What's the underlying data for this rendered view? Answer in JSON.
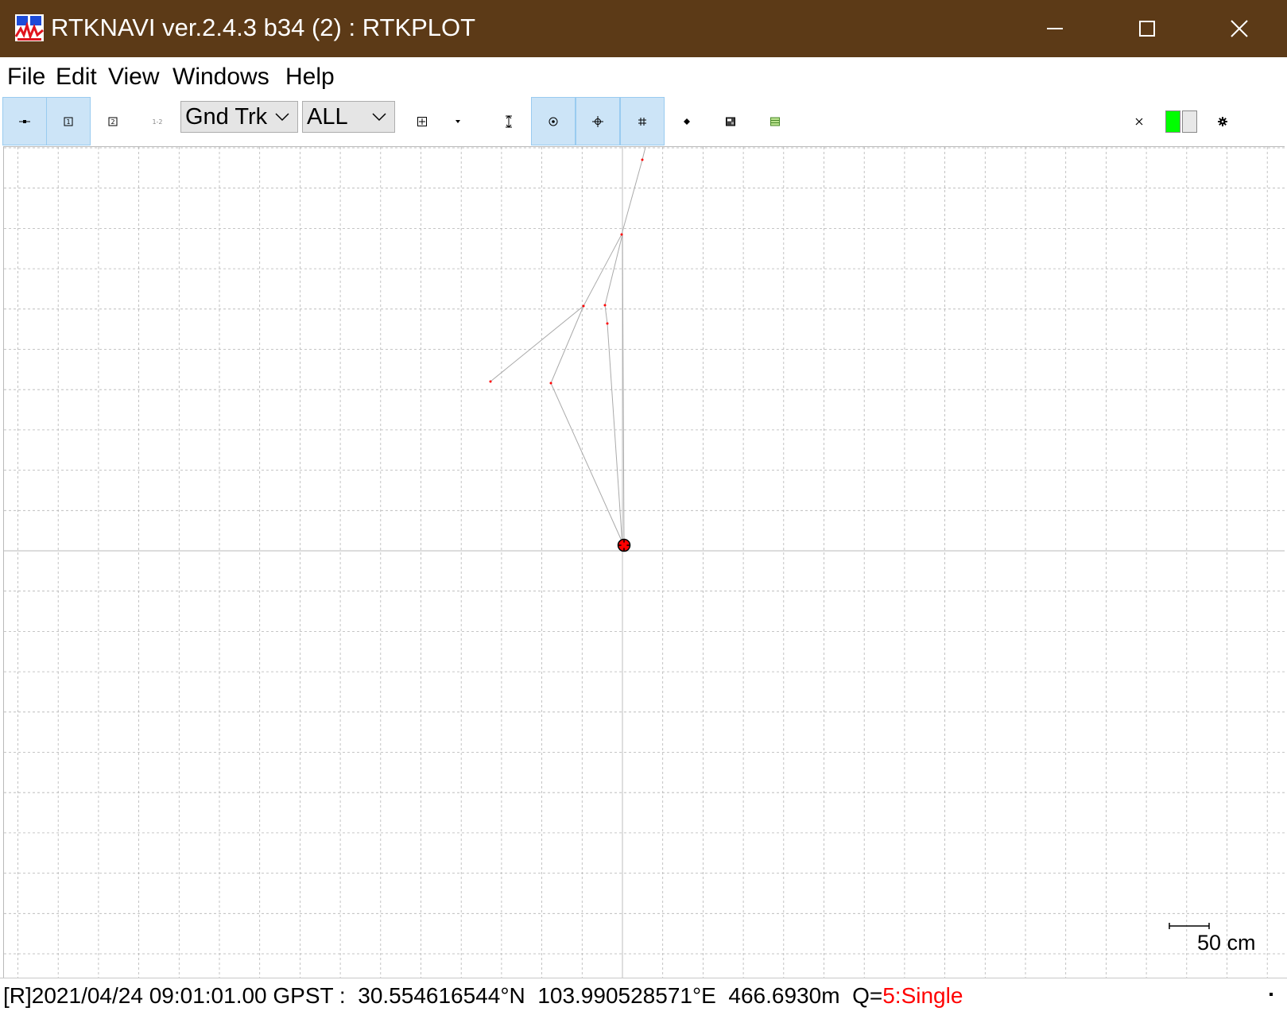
{
  "window": {
    "title": "RTKNAVI ver.2.4.3 b34 (2) : RTKPLOT",
    "controls": [
      "minimize-icon",
      "maximize-icon",
      "close-icon"
    ],
    "title_bar_color": "#5c3a17"
  },
  "menu": {
    "file": "File",
    "edit": "Edit",
    "view": "View",
    "windows": "Windows",
    "help": "Help"
  },
  "toolbar": {
    "plot_type": "Gnd Trk",
    "quality_filter": "ALL",
    "buttons": [
      {
        "icon": "solution-rover-icon",
        "active": true
      },
      {
        "icon": "solution-1-icon",
        "label": "1",
        "active": true
      },
      {
        "icon": "solution-2-icon",
        "label": "2",
        "active": false
      },
      {
        "icon": "solution-12-icon",
        "label": "12",
        "active": false
      },
      {
        "icon": "zoom-fit-icon",
        "active": false
      },
      {
        "icon": "dropdown-icon",
        "active": false
      },
      {
        "icon": "vertical-range-icon",
        "active": false
      },
      {
        "icon": "center-origin-icon",
        "active": true
      },
      {
        "icon": "crosshair-icon",
        "active": true
      },
      {
        "icon": "grid-icon",
        "active": true
      },
      {
        "icon": "point-icon",
        "active": false
      },
      {
        "icon": "map-image-icon",
        "active": false
      },
      {
        "icon": "map-layer-icon",
        "active": false
      },
      {
        "icon": "clear-icon",
        "active": false
      },
      {
        "icon": "settings-gear-icon",
        "active": false
      }
    ],
    "status_colors": {
      "connected": "#00ff00",
      "idle": "#e8e8e8"
    }
  },
  "plot": {
    "scale_label": "50 cm",
    "track_color": "#aaaaaa",
    "point_color": "#ff0000",
    "grid_color": "#b4b4b4"
  },
  "status": {
    "mode": "[R]",
    "datetime": "2021/04/24 09:01:01.00 GPST :",
    "latitude": "30.554616544°N",
    "longitude": "103.990528571°E",
    "height": "466.6930m",
    "q_label": "Q=",
    "q_value": "5:Single",
    "q_color": "#ff0000"
  }
}
